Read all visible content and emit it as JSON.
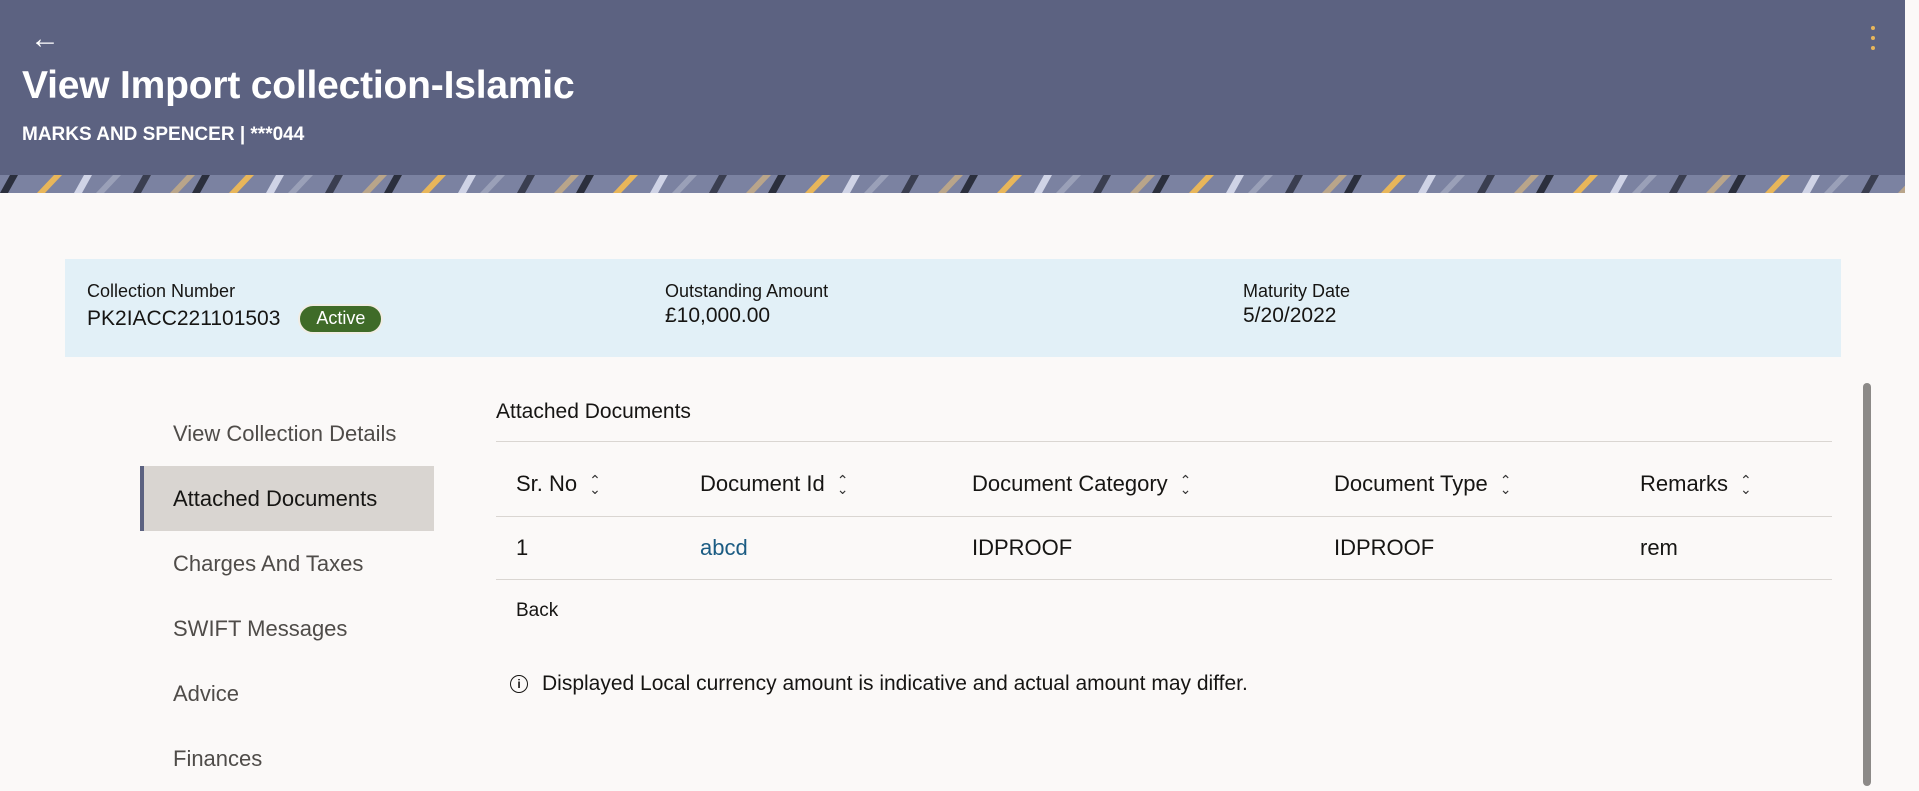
{
  "header": {
    "title": "View Import collection-Islamic",
    "subtitle": "MARKS AND SPENCER | ***044",
    "back_icon": "←"
  },
  "summary": {
    "collection_number_label": "Collection Number",
    "collection_number": "PK2IACC221101503",
    "status": "Active",
    "outstanding_label": "Outstanding Amount",
    "outstanding_value": "£10,000.00",
    "maturity_label": "Maturity Date",
    "maturity_value": "5/20/2022"
  },
  "sidenav": {
    "items": [
      {
        "label": "View Collection Details"
      },
      {
        "label": "Attached Documents"
      },
      {
        "label": "Charges And Taxes"
      },
      {
        "label": "SWIFT Messages"
      },
      {
        "label": "Advice"
      },
      {
        "label": "Finances"
      }
    ],
    "active_index": 1
  },
  "content": {
    "section_title": "Attached Documents",
    "columns": [
      "Sr. No",
      "Document Id",
      "Document Category",
      "Document Type",
      "Remarks"
    ],
    "rows": [
      {
        "sr_no": "1",
        "document_id": "abcd",
        "category": "IDPROOF",
        "type": "IDPROOF",
        "remarks": "rem"
      }
    ],
    "back_label": "Back",
    "info_text": "Displayed Local currency amount is indicative and actual amount may differ."
  },
  "colors": {
    "header_bg": "#5c6281",
    "summary_bg": "#e2f0f7",
    "badge_bg": "#3f6b28",
    "link": "#1b5c83"
  }
}
